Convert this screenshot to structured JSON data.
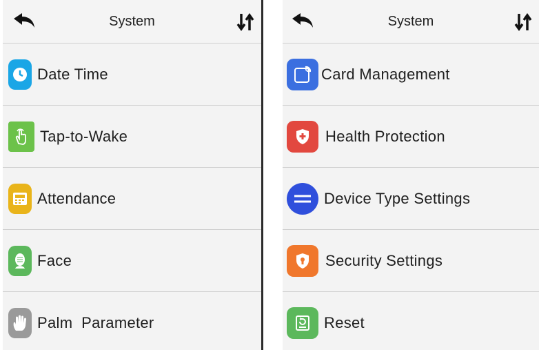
{
  "left_screen": {
    "header": {
      "title": "System",
      "back_icon": "back-arrow-icon",
      "sort_icon": "sort-arrows-icon"
    },
    "items": [
      {
        "label": "Date Time",
        "icon": "clock-icon",
        "color": "#1aa6e6"
      },
      {
        "label": "Tap-to-Wake",
        "icon": "tap-hand-icon",
        "color": "#6cc24a"
      },
      {
        "label": "Attendance",
        "icon": "attendance-icon",
        "color": "#e9b41a"
      },
      {
        "label": "Face",
        "icon": "face-icon",
        "color": "#5cb85c"
      },
      {
        "label": "Palm  Parameter",
        "icon": "palm-icon",
        "color": "#9a9a9a"
      }
    ]
  },
  "right_screen": {
    "header": {
      "title": "System",
      "back_icon": "back-arrow-icon",
      "sort_icon": "sort-arrows-icon"
    },
    "items": [
      {
        "label": "Card Management",
        "icon": "card-icon",
        "color": "#3b6fe0"
      },
      {
        "label": "Health Protection",
        "icon": "shield-plus-icon",
        "color": "#e2483f"
      },
      {
        "label": "Device Type Settings",
        "icon": "switch-icon",
        "color": "#2f4fdc"
      },
      {
        "label": "Security Settings",
        "icon": "security-shield-icon",
        "color": "#f0772c"
      },
      {
        "label": "Reset",
        "icon": "reset-icon",
        "color": "#5cb85c"
      }
    ]
  }
}
